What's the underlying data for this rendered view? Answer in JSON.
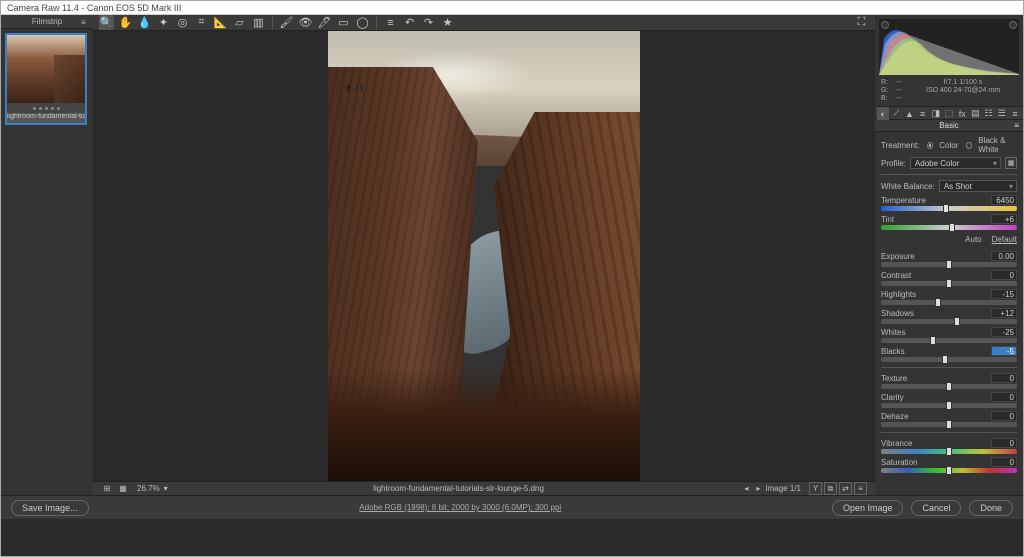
{
  "window": {
    "title": "Camera Raw 11.4  -  Canon EOS 5D Mark III"
  },
  "filmstrip": {
    "header": "Filmstrip",
    "thumb_label": "lightroom-fundamental-tutor..."
  },
  "toolbar": {
    "tools": [
      "zoom",
      "hand",
      "white-balance",
      "color-sampler",
      "target-adjust",
      "crop",
      "straighten",
      "transform",
      "guided",
      "spot-removal",
      "red-eye",
      "adjustment-brush",
      "graduated-filter",
      "radial-filter",
      "snapshot",
      "preferences"
    ],
    "rot": [
      "rotate-ccw",
      "rotate-cw",
      "toggle-mark"
    ]
  },
  "status": {
    "zoom": "26.7%",
    "filename": "lightroom-fundamental-tutorials-slr-lounge-5.dng",
    "nav": "Image 1/1"
  },
  "histogram": {
    "rgb": {
      "r": "R:",
      "g": "G:",
      "b": "B:",
      "rv": "--",
      "gv": "--",
      "bv": "--"
    },
    "exif1": "f/7.1    1/100 s",
    "exif2": "ISO 400    24-70@24 mm"
  },
  "tabs": {
    "title": "Basic"
  },
  "basic": {
    "treatment_label": "Treatment:",
    "color": "Color",
    "bw": "Black & White",
    "profile_label": "Profile:",
    "profile_value": "Adobe Color",
    "wb_label": "White Balance:",
    "wb_value": "As Shot",
    "auto": "Auto",
    "default": "Default",
    "sliders": {
      "temperature": {
        "label": "Temperature",
        "value": "6450",
        "pos": 48,
        "cls": "temp"
      },
      "tint": {
        "label": "Tint",
        "value": "+6",
        "pos": 52,
        "cls": "tint"
      },
      "exposure": {
        "label": "Exposure",
        "value": "0.00",
        "pos": 50
      },
      "contrast": {
        "label": "Contrast",
        "value": "0",
        "pos": 50
      },
      "highlights": {
        "label": "Highlights",
        "value": "-15",
        "pos": 42
      },
      "shadows": {
        "label": "Shadows",
        "value": "+12",
        "pos": 56
      },
      "whites": {
        "label": "Whites",
        "value": "-25",
        "pos": 38
      },
      "blacks": {
        "label": "Blacks",
        "value": "-5",
        "pos": 47,
        "hl": true
      },
      "texture": {
        "label": "Texture",
        "value": "0",
        "pos": 50
      },
      "clarity": {
        "label": "Clarity",
        "value": "0",
        "pos": 50
      },
      "dehaze": {
        "label": "Dehaze",
        "value": "0",
        "pos": 50
      },
      "vibrance": {
        "label": "Vibrance",
        "value": "0",
        "pos": 50,
        "cls": "vib"
      },
      "saturation": {
        "label": "Saturation",
        "value": "0",
        "pos": 50,
        "cls": "sat"
      }
    }
  },
  "footer": {
    "save": "Save Image...",
    "meta": "Adobe RGB (1998); 8 bit; 2000 by 3000 (6.0MP); 300 ppi",
    "open": "Open Image",
    "cancel": "Cancel",
    "done": "Done"
  }
}
